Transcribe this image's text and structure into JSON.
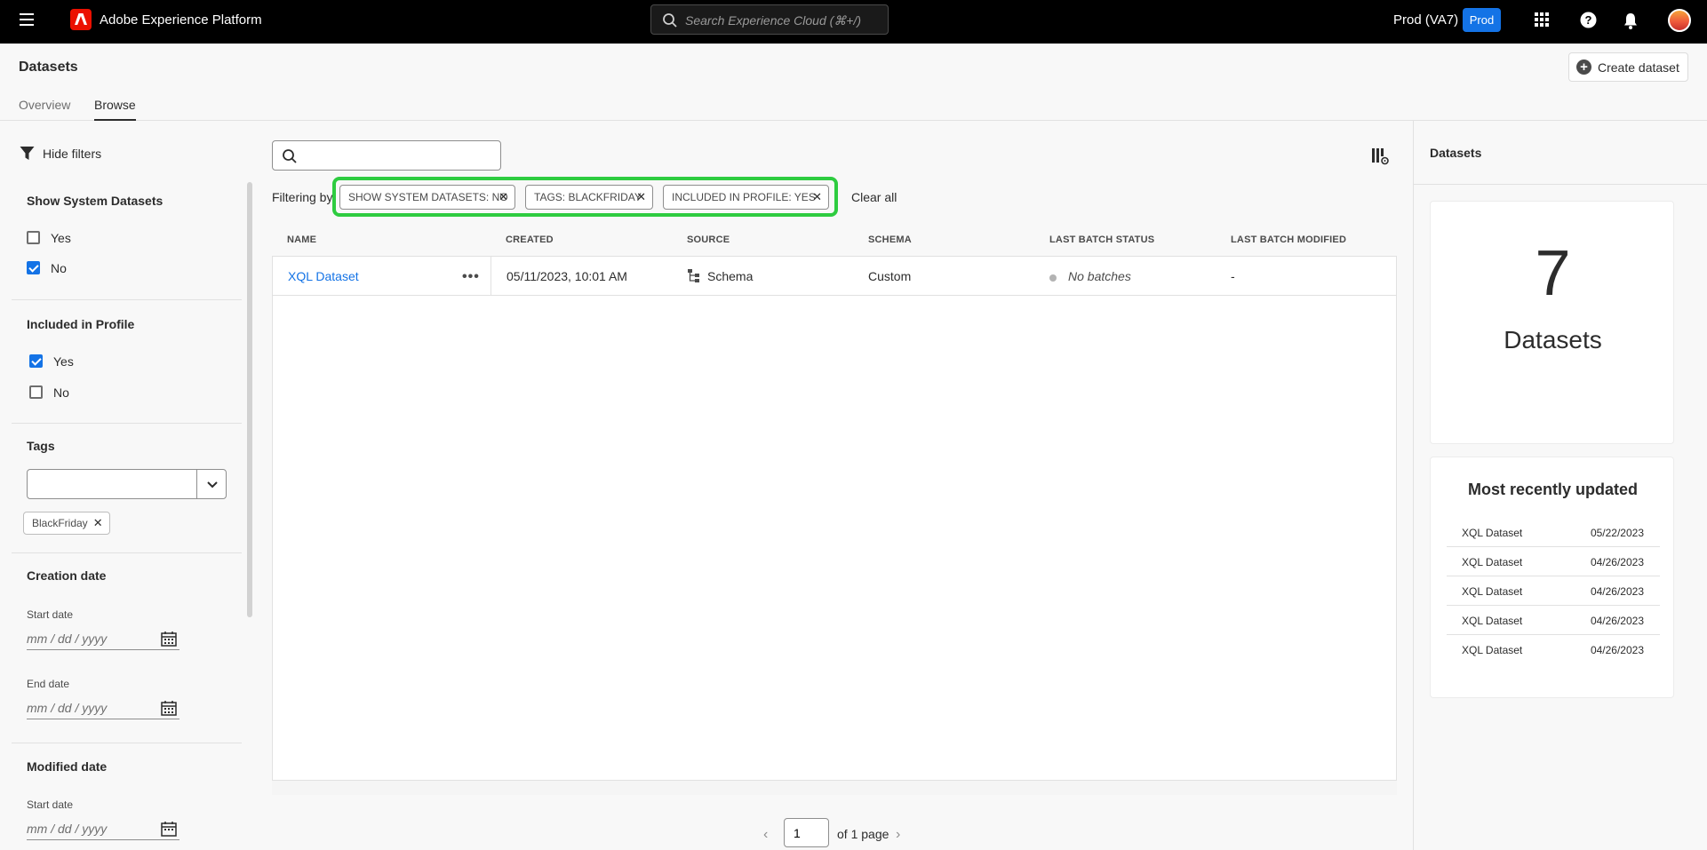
{
  "topbar": {
    "app_title": "Adobe Experience Platform",
    "search_placeholder": "Search Experience Cloud (⌘+/)",
    "org_name": "Prod (VA7)",
    "env_badge": "Prod"
  },
  "page": {
    "title": "Datasets",
    "create_button": "Create dataset",
    "tabs": [
      {
        "label": "Overview",
        "active": false
      },
      {
        "label": "Browse",
        "active": true
      }
    ]
  },
  "filters": {
    "hide_label": "Hide filters",
    "system_datasets": {
      "heading": "Show System Datasets",
      "options": [
        {
          "label": "Yes",
          "checked": false
        },
        {
          "label": "No",
          "checked": true
        }
      ]
    },
    "included_in_profile": {
      "heading": "Included in Profile",
      "options": [
        {
          "label": "Yes",
          "checked": true
        },
        {
          "label": "No",
          "checked": false
        }
      ]
    },
    "tags": {
      "heading": "Tags",
      "value": "",
      "selected": [
        "BlackFriday"
      ]
    },
    "creation_date": {
      "heading": "Creation date",
      "start_label": "Start date",
      "end_label": "End date",
      "placeholder": "mm / dd / yyyy"
    },
    "modified_date": {
      "heading": "Modified date",
      "start_label": "Start date",
      "placeholder": "mm / dd / yyyy"
    }
  },
  "applied": {
    "label": "Filtering by",
    "chips": [
      "SHOW SYSTEM DATASETS: NO",
      "TAGS: BLACKFRIDAY",
      "INCLUDED IN PROFILE: YES"
    ],
    "clear_all": "Clear all",
    "highlight_color": "#2ecc40"
  },
  "table": {
    "columns": [
      "NAME",
      "CREATED",
      "SOURCE",
      "SCHEMA",
      "LAST BATCH STATUS",
      "LAST BATCH MODIFIED"
    ],
    "rows": [
      {
        "name": "XQL Dataset",
        "created": "05/11/2023, 10:01 AM",
        "source": "Schema",
        "schema": "Custom",
        "last_batch_status": "No batches",
        "last_batch_modified": "-"
      }
    ]
  },
  "pagination": {
    "page": "1",
    "of_label": "of 1 page"
  },
  "summary": {
    "title": "Datasets",
    "count": "7",
    "count_label": "Datasets",
    "recent_title": "Most recently updated",
    "recent": [
      {
        "name": "XQL Dataset",
        "date": "05/22/2023"
      },
      {
        "name": "XQL Dataset",
        "date": "04/26/2023"
      },
      {
        "name": "XQL Dataset",
        "date": "04/26/2023"
      },
      {
        "name": "XQL Dataset",
        "date": "04/26/2023"
      },
      {
        "name": "XQL Dataset",
        "date": "04/26/2023"
      }
    ]
  },
  "colors": {
    "accent": "#1473e6",
    "brand_red": "#eb1000",
    "topbar_bg": "#000000"
  }
}
